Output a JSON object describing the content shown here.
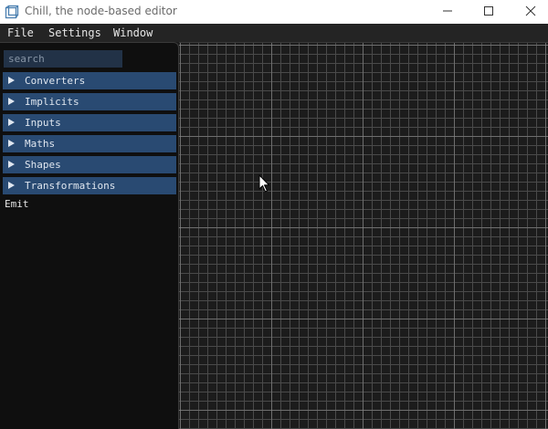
{
  "window": {
    "title": "Chill, the node-based editor"
  },
  "menubar": {
    "items": [
      "File",
      "Settings",
      "Window"
    ]
  },
  "sidebar": {
    "search": {
      "placeholder": "search",
      "value": ""
    },
    "categories": [
      {
        "label": "Converters",
        "expanded": false
      },
      {
        "label": "Implicits",
        "expanded": false
      },
      {
        "label": "Inputs",
        "expanded": false
      },
      {
        "label": "Maths",
        "expanded": false
      },
      {
        "label": "Shapes",
        "expanded": false
      },
      {
        "label": "Transformations",
        "expanded": false
      }
    ],
    "leaf_items": [
      "Emit"
    ]
  },
  "icons": {
    "app": "node-graph-app-icon",
    "minimize": "minimize-icon",
    "maximize": "maximize-icon",
    "close": "close-icon",
    "collapsed_arrow": "triangle-right-icon",
    "cursor": "mouse-pointer-icon"
  },
  "colors": {
    "category_bg": "#294a72",
    "search_bg": "#223247",
    "sidebar_bg": "#0f0f0f",
    "menubar_bg": "#242424",
    "canvas_bg": "#1c1c1c",
    "grid_minor": "#4a4a4a",
    "grid_major": "#7a7a7a"
  }
}
